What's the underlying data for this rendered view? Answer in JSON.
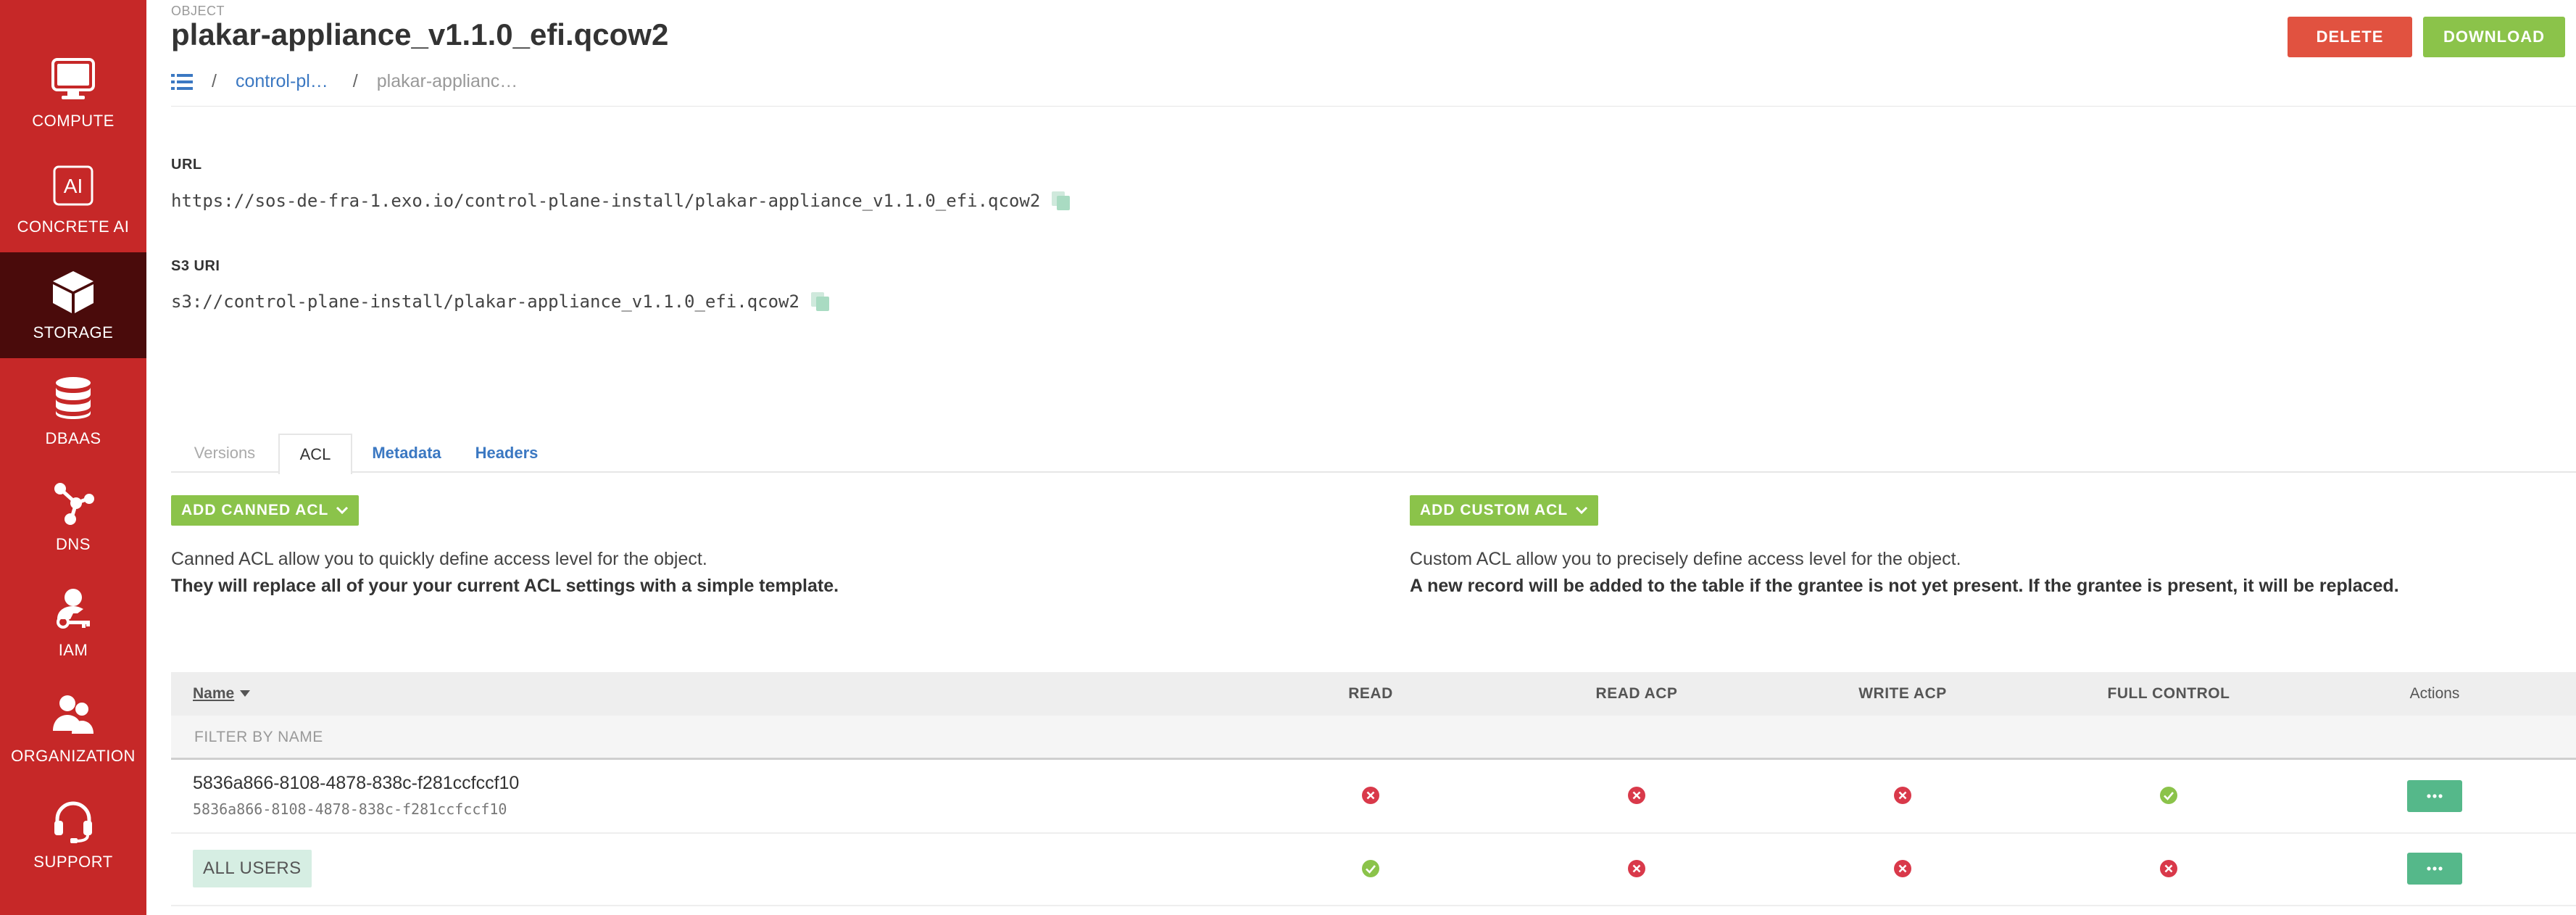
{
  "sidebar": {
    "items": [
      {
        "label": "COMPUTE",
        "icon": "monitor-icon"
      },
      {
        "label": "CONCRETE AI",
        "icon": "ai-icon"
      },
      {
        "label": "STORAGE",
        "icon": "cube-icon",
        "active": true
      },
      {
        "label": "DBAAS",
        "icon": "database-icon"
      },
      {
        "label": "DNS",
        "icon": "dns-network-icon"
      },
      {
        "label": "IAM",
        "icon": "user-key-icon"
      },
      {
        "label": "ORGANIZATION",
        "icon": "organization-users-icon"
      },
      {
        "label": "SUPPORT",
        "icon": "headset-icon"
      }
    ]
  },
  "header": {
    "object_label": "OBJECT",
    "title": "plakar-appliance_v1.1.0_efi.qcow2",
    "delete_label": "DELETE",
    "download_label": "DOWNLOAD"
  },
  "breadcrumb": {
    "separator": "/",
    "link": "control-pl…",
    "current": "plakar-applianc…"
  },
  "details": {
    "url_label": "URL",
    "url_value": "https://sos-de-fra-1.exo.io/control-plane-install/plakar-appliance_v1.1.0_efi.qcow2",
    "s3_label": "S3 URI",
    "s3_value": "s3://control-plane-install/plakar-appliance_v1.1.0_efi.qcow2"
  },
  "tabs": [
    {
      "label": "Versions",
      "state": "disabled"
    },
    {
      "label": "ACL",
      "state": "active"
    },
    {
      "label": "Metadata",
      "state": "link"
    },
    {
      "label": "Headers",
      "state": "link"
    }
  ],
  "acl": {
    "canned_button": "ADD CANNED ACL",
    "canned_desc_1": "Canned ACL allow you to quickly define access level for the object.",
    "canned_desc_2": "They will replace all of your your current ACL settings with a simple template.",
    "custom_button": "ADD CUSTOM ACL",
    "custom_desc_1": "Custom ACL allow you to precisely define access level for the object.",
    "custom_desc_2": "A new record will be added to the table if the grantee is not yet present. If the grantee is present, it will be replaced."
  },
  "table": {
    "columns": [
      "Name",
      "READ",
      "READ ACP",
      "WRITE ACP",
      "FULL CONTROL",
      "Actions"
    ],
    "filter_placeholder": "FILTER BY NAME",
    "rows": [
      {
        "name": "5836a866-8108-4878-838c-f281ccfccf10",
        "sub": "5836a866-8108-4878-838c-f281ccfccf10",
        "read": false,
        "read_acp": false,
        "write_acp": false,
        "full_control": true
      },
      {
        "badge": "ALL USERS",
        "read": true,
        "read_acp": false,
        "write_acp": false,
        "full_control": false
      }
    ]
  },
  "colors": {
    "sidebar": "#c62828",
    "sidebar_active": "#4a0b0b",
    "delete": "#e15240",
    "green": "#8bc34a",
    "action": "#55b88a",
    "link": "#3b78c2",
    "check": "#8bc34a",
    "cross": "#d9394a"
  }
}
